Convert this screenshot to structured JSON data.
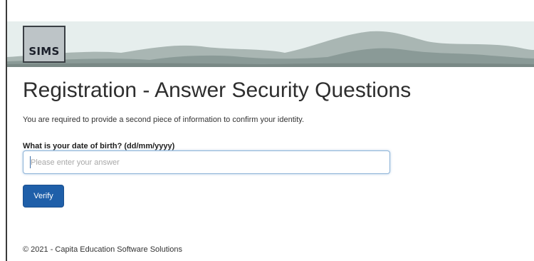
{
  "header": {
    "logo_text": "SIMS"
  },
  "main": {
    "title": "Registration - Answer Security Questions",
    "intro": "You are required to provide a second piece of information to confirm your identity.",
    "question_label": "What is your date of birth? (dd/mm/yyyy)",
    "answer_placeholder": "Please enter your answer",
    "answer_value": "",
    "verify_label": "Verify"
  },
  "footer": {
    "copyright": "© 2021 - Capita Education Software Solutions"
  },
  "colors": {
    "accent": "#1f5fa9",
    "banner_sky": "#e6eeed",
    "mountains": "#8a9a97"
  }
}
